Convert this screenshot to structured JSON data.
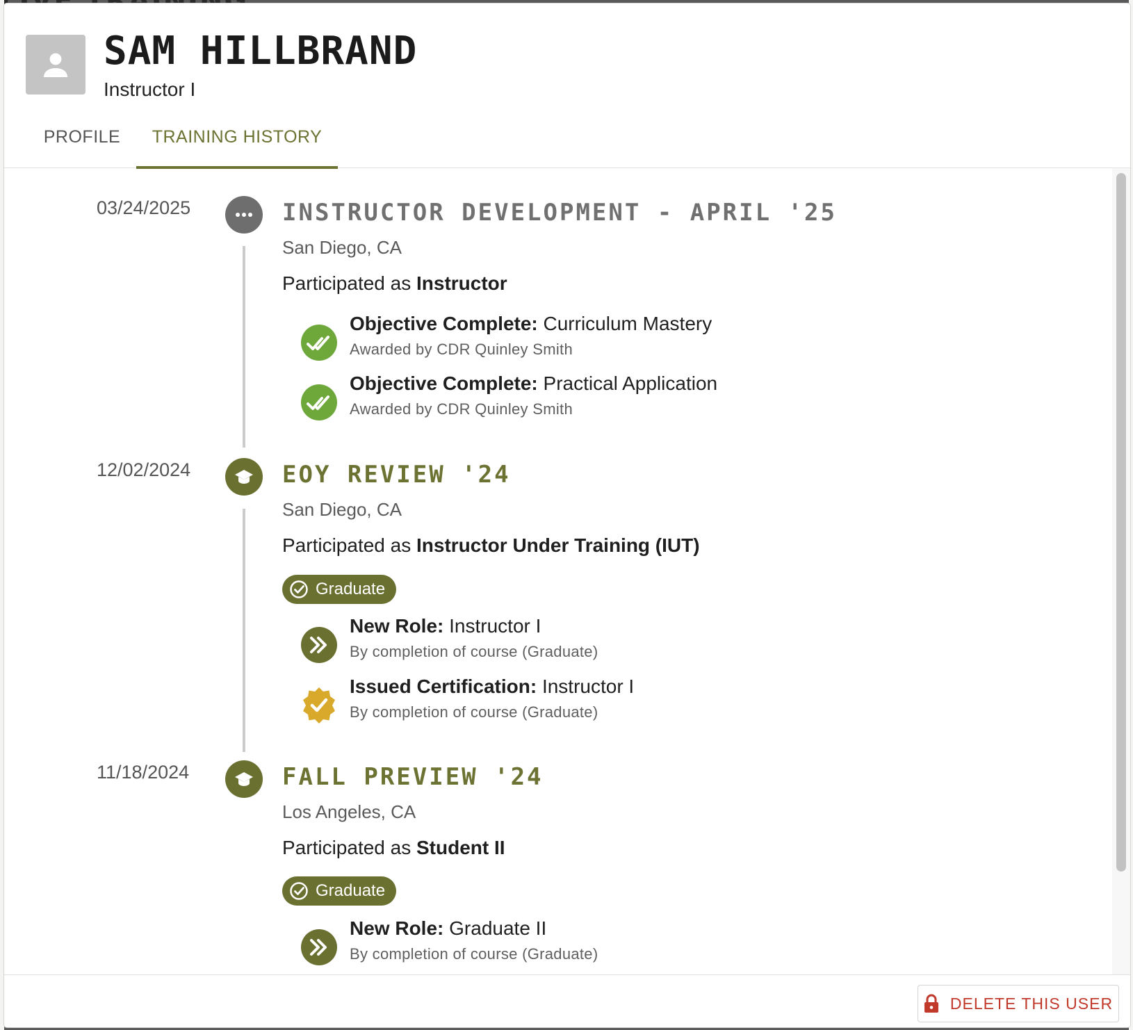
{
  "backdrop": {
    "title_fragment": "LIVE TRAINING"
  },
  "colors": {
    "accent": "#6c7231",
    "node_grey": "#6e6e6e",
    "objective_green": "#6ea83b",
    "cert_gold": "#d9a92b",
    "danger": "#c0392b"
  },
  "user": {
    "name": "SAM HILLBRAND",
    "role": "Instructor I",
    "avatar_icon": "person-icon"
  },
  "tabs": [
    {
      "label": "PROFILE",
      "active": false
    },
    {
      "label": "TRAINING HISTORY",
      "active": true
    }
  ],
  "events": [
    {
      "date": "03/24/2025",
      "icon": "more-horizontal-icon",
      "title": "INSTRUCTOR DEVELOPMENT - APRIL '25",
      "location": "San Diego, CA",
      "participated_prefix": "Participated as",
      "role": "Instructor",
      "items": [
        {
          "icon": "double-check-icon",
          "label": "Objective Complete:",
          "value": "Curriculum Mastery",
          "sub": "Awarded by CDR Quinley Smith"
        },
        {
          "icon": "double-check-icon",
          "label": "Objective Complete:",
          "value": "Practical Application",
          "sub": "Awarded by CDR Quinley Smith"
        }
      ]
    },
    {
      "date": "12/02/2024",
      "icon": "graduation-cap-icon",
      "title": "EOY REVIEW '24",
      "location": "San Diego, CA",
      "participated_prefix": "Participated as",
      "role": "Instructor Under Training (IUT)",
      "badge": "Graduate",
      "items": [
        {
          "icon": "double-chevron-right-icon",
          "label": "New Role:",
          "value": "Instructor I",
          "sub": "By completion of course (Graduate)"
        },
        {
          "icon": "certification-badge-icon",
          "label": "Issued Certification:",
          "value": "Instructor I",
          "sub": "By completion of course (Graduate)"
        }
      ]
    },
    {
      "date": "11/18/2024",
      "icon": "graduation-cap-icon",
      "title": "FALL PREVIEW '24",
      "location": "Los Angeles, CA",
      "participated_prefix": "Participated as",
      "role": "Student II",
      "badge": "Graduate",
      "items": [
        {
          "icon": "double-chevron-right-icon",
          "label": "New Role:",
          "value": "Graduate II",
          "sub": "By completion of course (Graduate)"
        }
      ]
    }
  ],
  "footer": {
    "delete_label": "DELETE THIS USER",
    "delete_icon": "lock-icon"
  }
}
